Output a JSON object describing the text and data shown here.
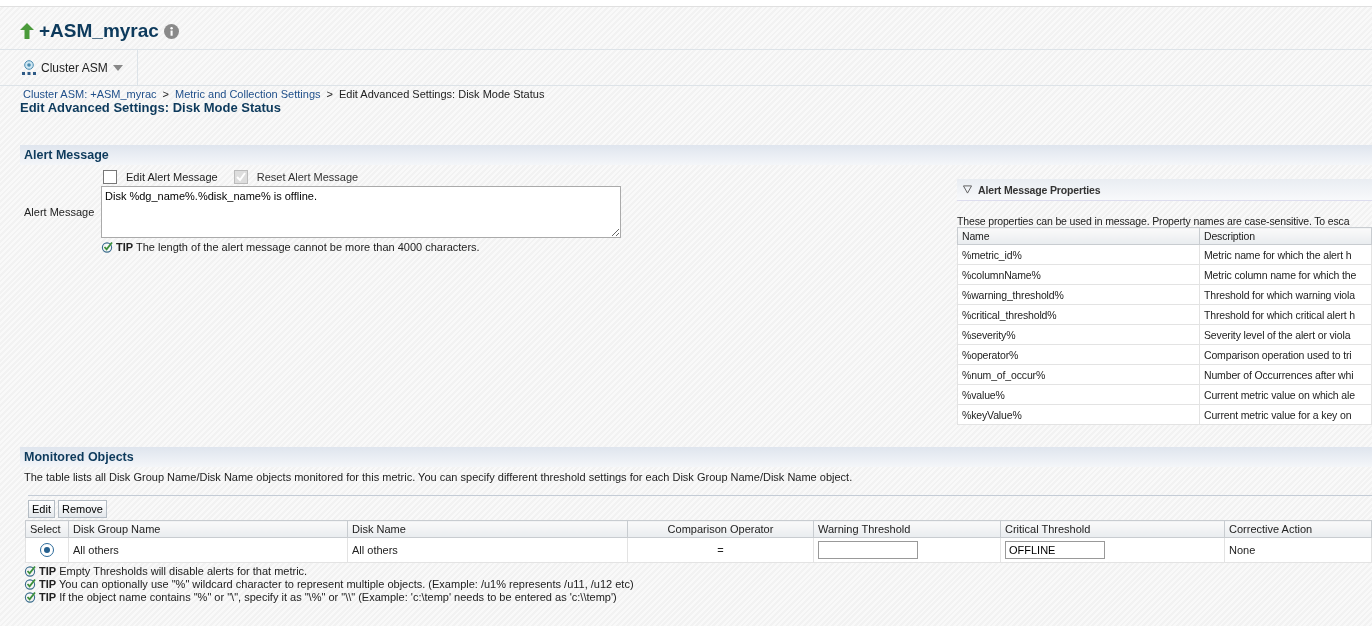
{
  "target": {
    "title": "+ASM_myrac",
    "up": true
  },
  "menu": {
    "label": "Cluster ASM"
  },
  "breadcrumb": {
    "separator": ">",
    "items": [
      {
        "label": "Cluster ASM: +ASM_myrac",
        "link": true
      },
      {
        "label": "Metric and Collection Settings",
        "link": true
      },
      {
        "label": "Edit Advanced Settings: Disk Mode Status",
        "link": false
      }
    ]
  },
  "page_title": "Edit Advanced Settings: Disk Mode Status",
  "alert_message": {
    "heading": "Alert Message",
    "options": [
      {
        "label": "Edit Alert Message",
        "checked": false,
        "disabled": false
      },
      {
        "label": "Reset Alert Message",
        "checked": true,
        "disabled": true
      }
    ],
    "field_label": "Alert Message",
    "value": "Disk %dg_name%.%disk_name% is offline.",
    "tip": "**TIP** The length of the alert message cannot be more than 4000 characters."
  },
  "properties": {
    "heading": "Alert Message Properties",
    "expanded": true,
    "intro": "These properties can be used in message. Property names are case-sensitive. To esca",
    "columns": [
      "Name",
      "Description"
    ],
    "rows": [
      {
        "name": "%metric_id%",
        "description": "Metric name for which the alert h"
      },
      {
        "name": "%columnName%",
        "description": "Metric column name for which the"
      },
      {
        "name": "%warning_threshold%",
        "description": "Threshold for which warning viola"
      },
      {
        "name": "%critical_threshold%",
        "description": "Threshold for which critical alert h"
      },
      {
        "name": "%severity%",
        "description": "Severity level of the alert or viola"
      },
      {
        "name": "%operator%",
        "description": "Comparison operation used to tri"
      },
      {
        "name": "%num_of_occur%",
        "description": "Number of Occurrences after whi"
      },
      {
        "name": "%value%",
        "description": "Current metric value on which ale"
      },
      {
        "name": "%keyValue%",
        "description": "Current metric value for a key on"
      }
    ]
  },
  "monitored": {
    "heading": "Monitored Objects",
    "description": "The table lists all Disk Group Name/Disk Name objects monitored for this metric. You can specify different threshold settings for each Disk Group Name/Disk Name object.",
    "buttons": [
      "Edit",
      "Remove"
    ],
    "columns": [
      "Select",
      "Disk Group Name",
      "Disk Name",
      "Comparison Operator",
      "Warning Threshold",
      "Critical Threshold",
      "Corrective Action"
    ],
    "rows": [
      {
        "selected": true,
        "disk_group": "All others",
        "disk_name": "All others",
        "operator": "=",
        "critical": "OFFLINE",
        "action": "None"
      }
    ],
    "tips": [
      "**TIP** Empty Thresholds will disable alerts for that metric.",
      "**TIP** You can optionally use \"%\" wildcard character to represent multiple objects. (Example: /u1% represents /u11, /u12 etc)",
      "**TIP** If the object name contains \"%\" or \"\\\", specify it as \"\\%\" or \"\\\\\" (Example: 'c:\\temp' needs to be entered as 'c:\\\\temp')"
    ]
  }
}
